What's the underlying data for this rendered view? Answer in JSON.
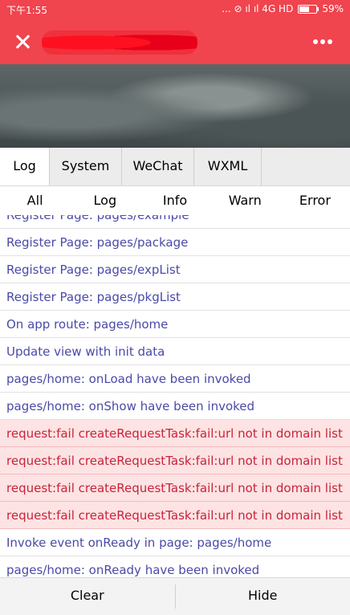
{
  "status_bar": {
    "time": "下午1:55",
    "indicators": "... ⊘ ıl ıl 4G HD",
    "battery_percent": "59%",
    "battery_level": 0.59
  },
  "nav": {
    "title_redacted": true,
    "close_icon": "close-icon",
    "more_icon": "more-dots-icon"
  },
  "tabs": [
    {
      "label": "Log",
      "active": true
    },
    {
      "label": "System",
      "active": false
    },
    {
      "label": "WeChat",
      "active": false
    },
    {
      "label": "WXML",
      "active": false
    }
  ],
  "filters": [
    "All",
    "Log",
    "Info",
    "Warn",
    "Error"
  ],
  "logs": [
    {
      "text": "Register Page: pages/example",
      "level": "log"
    },
    {
      "text": "Register Page: pages/package",
      "level": "log"
    },
    {
      "text": "Register Page: pages/expList",
      "level": "log"
    },
    {
      "text": "Register Page: pages/pkgList",
      "level": "log"
    },
    {
      "text": "On app route: pages/home",
      "level": "log"
    },
    {
      "text": "Update view with init data",
      "level": "log"
    },
    {
      "text": "pages/home: onLoad have been invoked",
      "level": "log"
    },
    {
      "text": "pages/home: onShow have been invoked",
      "level": "log"
    },
    {
      "text": "request:fail createRequestTask:fail:url not in domain list",
      "level": "error"
    },
    {
      "text": "request:fail createRequestTask:fail:url not in domain list",
      "level": "error"
    },
    {
      "text": "request:fail createRequestTask:fail:url not in domain list",
      "level": "error"
    },
    {
      "text": "request:fail createRequestTask:fail:url not in domain list",
      "level": "error"
    },
    {
      "text": "Invoke event onReady in page: pages/home",
      "level": "log"
    },
    {
      "text": "pages/home: onReady have been invoked",
      "level": "log"
    }
  ],
  "bottom": {
    "clear_label": "Clear",
    "hide_label": "Hide"
  },
  "colors": {
    "header": "#f0444f",
    "log_text": "#4a4aa8",
    "error_text": "#c8233a",
    "error_bg": "#fde3e3"
  }
}
